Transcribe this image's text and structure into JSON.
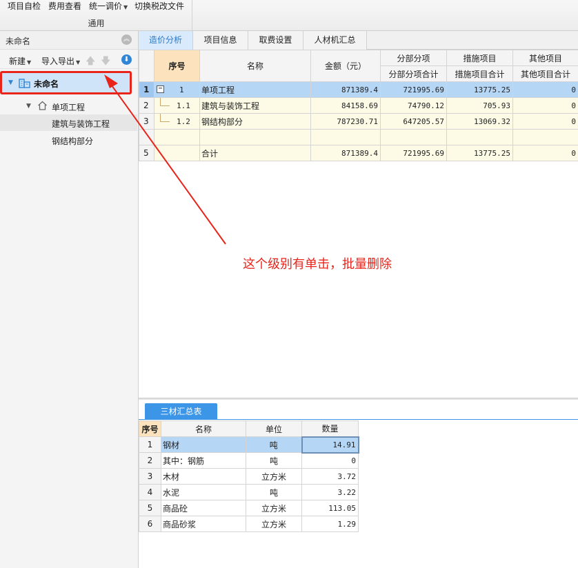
{
  "ribbon": {
    "buttons": [
      {
        "label": "项目自检",
        "dropdown": false
      },
      {
        "label": "费用查看",
        "dropdown": false
      },
      {
        "label": "统一调价",
        "dropdown": true
      },
      {
        "label": "切换税改文件",
        "dropdown": false
      }
    ],
    "group_label": "通用"
  },
  "left_panel": {
    "title": "未命名",
    "toolbar": {
      "new_label": "新建",
      "import_export_label": "导入导出"
    },
    "tree": [
      {
        "label": "未命名",
        "level": 0,
        "selected": true
      },
      {
        "label": "单项工程",
        "level": 1
      },
      {
        "label": "建筑与装饰工程",
        "level": 2,
        "highlighted": true
      },
      {
        "label": "钢结构部分",
        "level": 2
      }
    ]
  },
  "tabs": [
    "造价分析",
    "项目信息",
    "取费设置",
    "人材机汇总"
  ],
  "active_tab": "造价分析",
  "main_table": {
    "headers": {
      "seq": "序号",
      "name": "名称",
      "amount": "金额（元）",
      "fbfx_group": "分部分项",
      "fbfx_sub": "分部分项合计",
      "csxm_group": "措施项目",
      "csxm_sub": "措施项目合计",
      "qtxm_group": "其他项目",
      "qtxm_sub": "其他项目合计"
    },
    "rows": [
      {
        "rownum": "1",
        "seq": "1",
        "name": "单项工程",
        "amount": "871389.4",
        "fbfx": "721995.69",
        "csxm": "13775.25",
        "qtxm": "0"
      },
      {
        "rownum": "2",
        "seq": "1.1",
        "name": "建筑与装饰工程",
        "amount": "84158.69",
        "fbfx": "74790.12",
        "csxm": "705.93",
        "qtxm": "0"
      },
      {
        "rownum": "3",
        "seq": "1.2",
        "name": "钢结构部分",
        "amount": "787230.71",
        "fbfx": "647205.57",
        "csxm": "13069.32",
        "qtxm": "0"
      },
      {
        "rownum": "",
        "seq": "",
        "name": "",
        "amount": "",
        "fbfx": "",
        "csxm": "",
        "qtxm": ""
      },
      {
        "rownum": "5",
        "seq": "",
        "name": "合计",
        "amount": "871389.4",
        "fbfx": "721995.69",
        "csxm": "13775.25",
        "qtxm": "0"
      }
    ]
  },
  "annotation": {
    "text": "这个级别有单击，批量删除",
    "color": "#e8241b"
  },
  "bottom": {
    "tab_label": "三材汇总表",
    "headers": {
      "seq": "序号",
      "name": "名称",
      "unit": "单位",
      "qty": "数量"
    },
    "rows": [
      {
        "seq": "1",
        "name": "钢材",
        "unit": "吨",
        "qty": "14.91"
      },
      {
        "seq": "2",
        "name": "其中：钢筋",
        "unit": "吨",
        "qty": "0"
      },
      {
        "seq": "3",
        "name": "木材",
        "unit": "立方米",
        "qty": "3.72"
      },
      {
        "seq": "4",
        "name": "水泥",
        "unit": "吨",
        "qty": "3.22"
      },
      {
        "seq": "5",
        "name": "商品砼",
        "unit": "立方米",
        "qty": "113.05"
      },
      {
        "seq": "6",
        "name": "商品砂浆",
        "unit": "立方米",
        "qty": "1.29"
      }
    ]
  },
  "colors": {
    "accent": "#3c95e6",
    "selection": "#b6d6f5",
    "annotation": "#e8241b",
    "header_seq": "#fde3bd"
  }
}
